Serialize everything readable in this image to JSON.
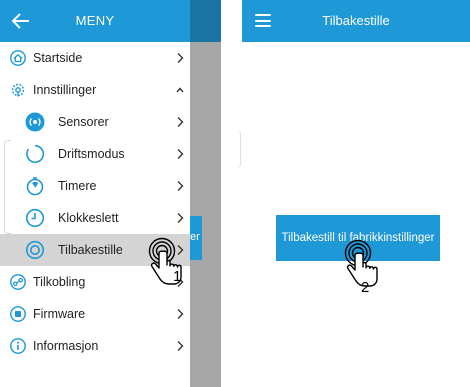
{
  "menu": {
    "title": "MENY",
    "items": [
      {
        "label": "Startside",
        "icon": "home-icon",
        "chevron": "right"
      },
      {
        "label": "Innstillinger",
        "icon": "settings-icon",
        "chevron": "up"
      },
      {
        "label": "Sensorer",
        "icon": "sensor-icon",
        "chevron": "right"
      },
      {
        "label": "Driftsmodus",
        "icon": "operating-mode-icon",
        "chevron": "right"
      },
      {
        "label": "Timere",
        "icon": "timer-icon",
        "chevron": "right"
      },
      {
        "label": "Klokkeslett",
        "icon": "clock-icon",
        "chevron": "right"
      },
      {
        "label": "Tilbakestille",
        "icon": "reset-icon",
        "chevron": "right"
      },
      {
        "label": "Tilkobling",
        "icon": "connection-icon",
        "chevron": "right"
      },
      {
        "label": "Firmware",
        "icon": "firmware-icon",
        "chevron": "right"
      },
      {
        "label": "Informasjon",
        "icon": "info-icon",
        "chevron": "right"
      }
    ],
    "overlay_partial_text": "er"
  },
  "reset_screen": {
    "title": "Tilbakestille",
    "button_label": "Tilbakestill til fabrikkinstillinger"
  },
  "steps": {
    "step1": "1",
    "step2": "2"
  },
  "colors": {
    "accent": "#1e98d6",
    "selected_row": "#d4d4d4",
    "overlay": "#a7a7a7"
  }
}
